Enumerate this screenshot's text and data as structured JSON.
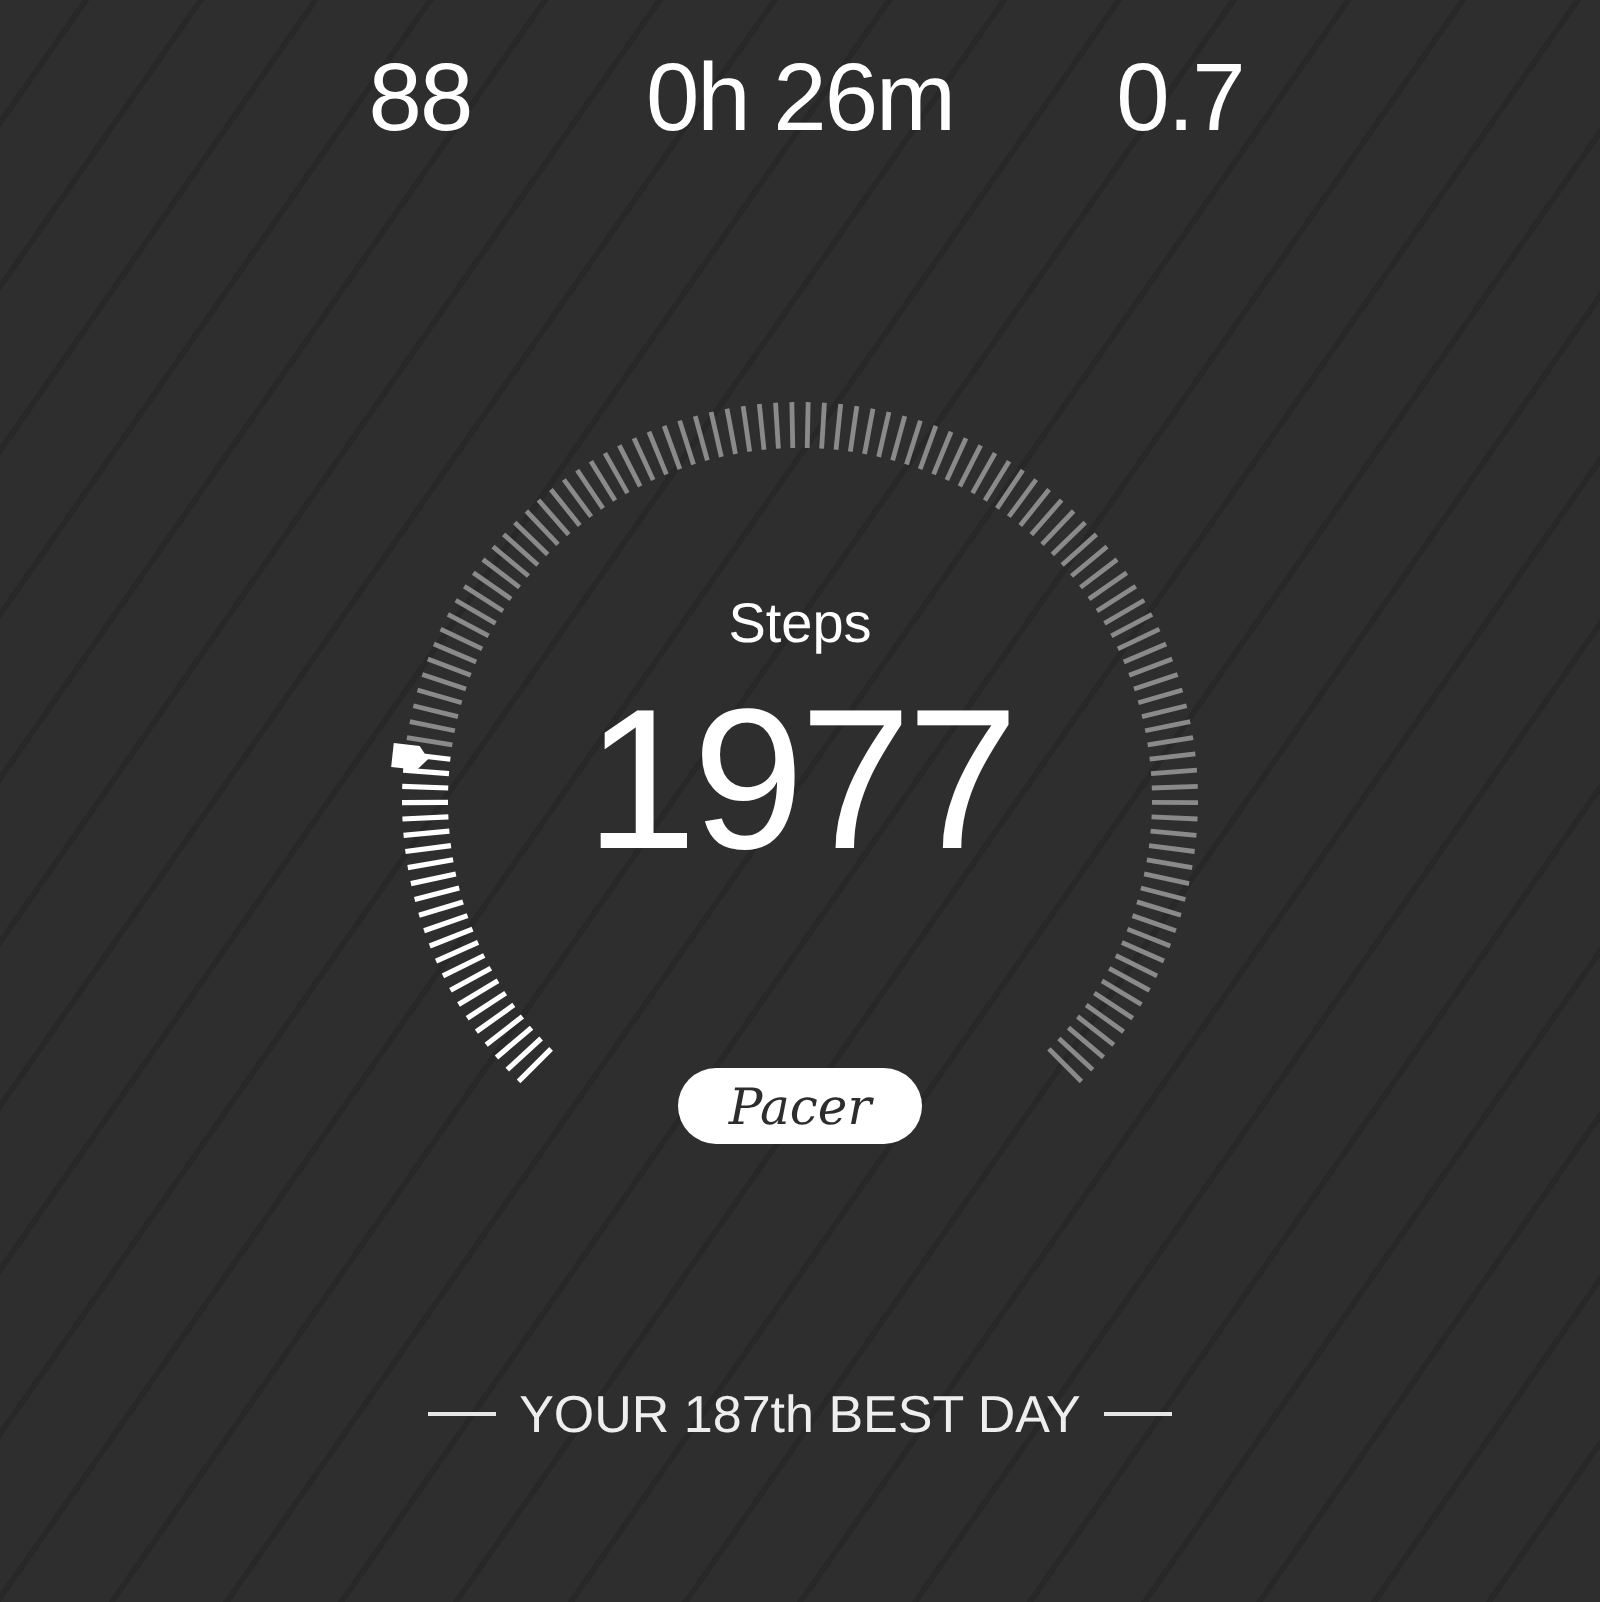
{
  "stats": [
    {
      "value": "88"
    },
    {
      "value": "0h 26m"
    },
    {
      "value": "0.7"
    }
  ],
  "gauge": {
    "label": "Steps",
    "value": "1977"
  },
  "badge": {
    "text": "Pacer"
  },
  "rank": {
    "text": "YOUR 187th BEST DAY"
  }
}
